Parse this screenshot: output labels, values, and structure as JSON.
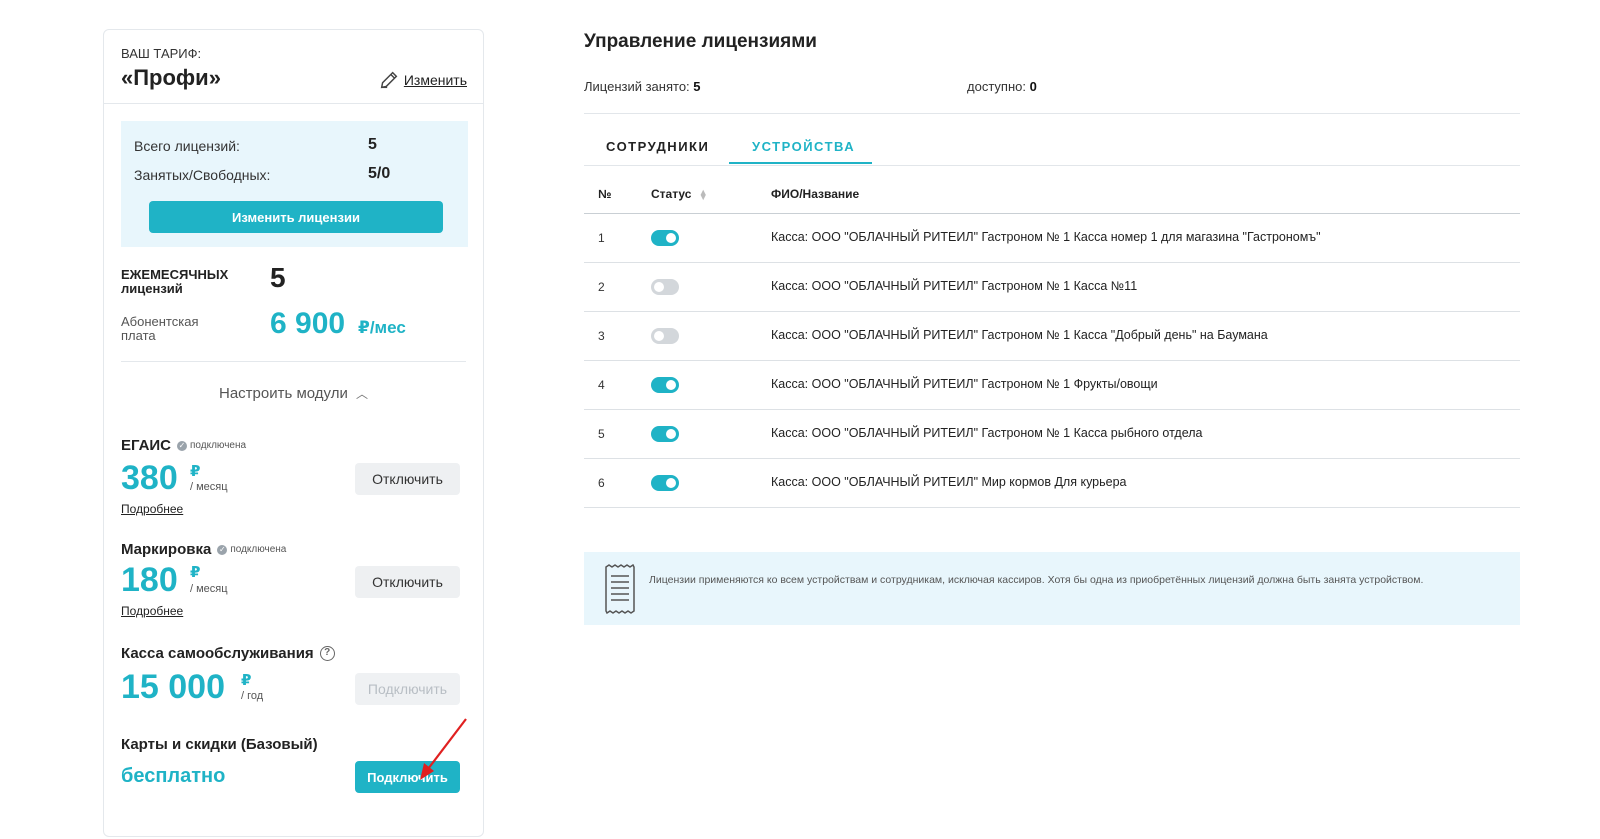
{
  "tariff": {
    "caption": "ВАШ ТАРИФ:",
    "name": "«Профи»",
    "edit_label": "Изменить"
  },
  "licenses_box": {
    "total_label": "Всего лицензий:",
    "total_value": "5",
    "busy_free_label": "Занятых/Свободных:",
    "busy_free_value": "5/0",
    "change_button": "Изменить лицензии"
  },
  "monthly": {
    "label": "ЕЖЕМЕСЯЧНЫХ лицензий",
    "value": "5",
    "fee_label": "Абонентская плата",
    "fee_value": "6 900",
    "fee_unit": "₽/мес"
  },
  "modules_toggle": "Настроить модули",
  "modules": {
    "egais": {
      "title": "ЕГАИС",
      "badge": "подключена",
      "price": "380",
      "currency": "₽",
      "period": "/ месяц",
      "more": "Подробнее",
      "button": "Отключить"
    },
    "marking": {
      "title": "Маркировка",
      "badge": "подключена",
      "price": "180",
      "currency": "₽",
      "period": "/ месяц",
      "more": "Подробнее",
      "button": "Отключить"
    },
    "selfservice": {
      "title": "Касса самообслуживания",
      "help": "?",
      "price": "15 000",
      "currency": "₽",
      "period": "/ год",
      "button": "Подключить"
    },
    "cards": {
      "title": "Карты и скидки (Базовый)",
      "price": "бесплатно",
      "button": "Подключить"
    }
  },
  "management": {
    "title": "Управление лицензиями",
    "used_label": "Лицензий занято:",
    "used_value": "5",
    "available_label": "доступно:",
    "available_value": "0",
    "tabs": {
      "employees": "СОТРУДНИКИ",
      "devices": "УСТРОЙСТВА"
    },
    "columns": {
      "num": "№",
      "status": "Статус",
      "name": "ФИО/Название"
    },
    "rows": [
      {
        "num": "1",
        "on": true,
        "name": "Касса: ООО \"ОБЛАЧНЫЙ РИТЕИЛ\" Гастроном № 1 Касса номер 1 для магазина \"Гастрономъ\""
      },
      {
        "num": "2",
        "on": false,
        "name": "Касса: ООО \"ОБЛАЧНЫЙ РИТЕИЛ\" Гастроном № 1 Касса №11"
      },
      {
        "num": "3",
        "on": false,
        "name": "Касса: ООО \"ОБЛАЧНЫЙ РИТЕИЛ\" Гастроном № 1 Касса \"Добрый день\" на Баумана"
      },
      {
        "num": "4",
        "on": true,
        "name": "Касса: ООО \"ОБЛАЧНЫЙ РИТЕИЛ\" Гастроном № 1 Фрукты/овощи"
      },
      {
        "num": "5",
        "on": true,
        "name": "Касса: ООО \"ОБЛАЧНЫЙ РИТЕИЛ\" Гастроном № 1 Касса рыбного отдела"
      },
      {
        "num": "6",
        "on": true,
        "name": "Касса: ООО \"ОБЛАЧНЫЙ РИТЕИЛ\" Мир кормов Для курьера"
      }
    ],
    "info_text": "Лицензии применяются ко всем устройствам и сотрудникам, исключая кассиров. Хотя бы одна из приобретённых лицензий должна быть занята устройством."
  },
  "colors": {
    "accent": "#1fb3c6",
    "light_bg": "#e8f6fc",
    "toggle_off": "#d3d7db",
    "arrow": "#e02020"
  },
  "icons": {
    "edit": "pencil-icon",
    "badge": "check-circle-icon",
    "help": "question-circle-icon",
    "info": "receipt-icon",
    "sort": "sort-icon",
    "toggle": "chevron-up-icon"
  }
}
